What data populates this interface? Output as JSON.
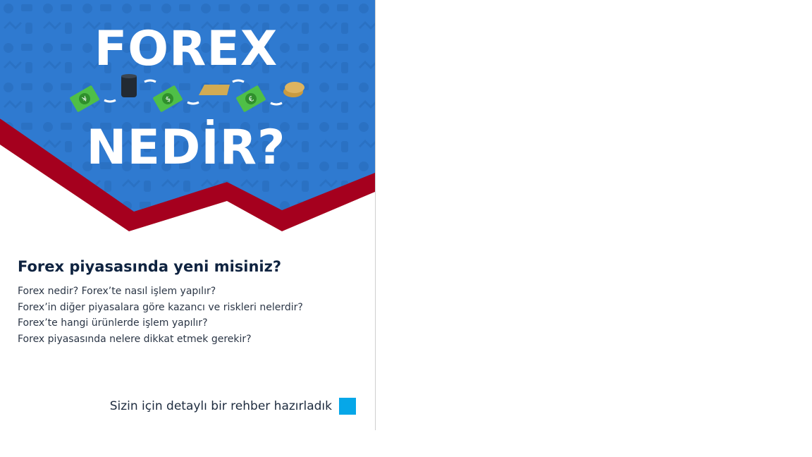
{
  "hero": {
    "line1": "FOREX",
    "line2": "NEDİR?",
    "colors": {
      "background": "#2f7ad0",
      "ribbon": "#a5001e",
      "text": "#ffffff"
    },
    "icons": [
      "yen-banknote-icon",
      "oil-barrel-icon",
      "dollar-banknote-icon",
      "gold-bar-icon",
      "euro-banknote-icon",
      "coins-icon"
    ]
  },
  "intro": {
    "heading": "Forex piyasasında yeni misiniz?",
    "questions": [
      "Forex nedir? Forex’te nasıl işlem yapılır?",
      "Forex’in diğer piyasalara göre kazancı ve riskleri nelerdir?",
      "Forex’te hangi ürünlerde işlem yapılır?",
      "Forex piyasasında nelere dikkat etmek gerekir?"
    ]
  },
  "guide": {
    "label": "Sizin için detaylı bir rehber hazırladık",
    "button_color": "#06a7e8"
  }
}
